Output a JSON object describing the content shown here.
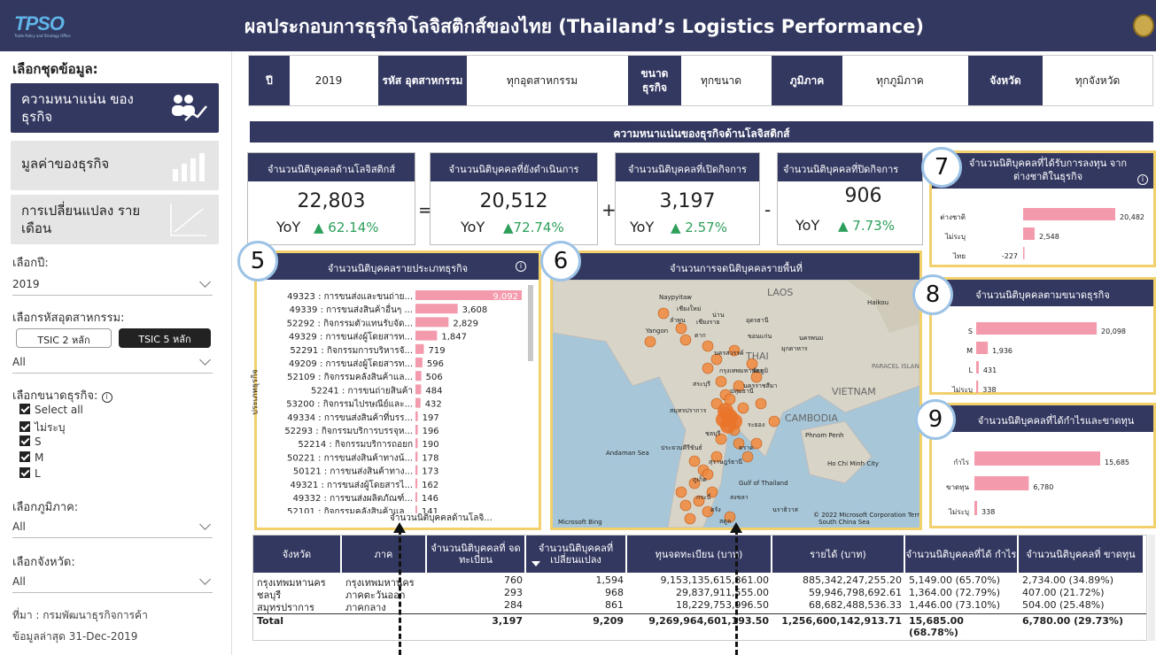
{
  "header": {
    "logo": "TPSO",
    "logo_sub": "Trade Policy and Strategy Office",
    "title": "ผลประกอบการธุรกิจโลจิสติกส์ของไทย (Thailand’s Logistics Performance)"
  },
  "sidebar": {
    "heading": "เลือกชุดข้อมูล:",
    "nav": [
      {
        "label": "ความหนาแน่น ของธุรกิจ"
      },
      {
        "label": "มูลค่าของธุรกิจ"
      },
      {
        "label": "การเปลี่ยนแปลง รายเดือน"
      }
    ],
    "year_label": "เลือกปี:",
    "year_value": "2019",
    "tsic_label": "เลือกรหัสอุตสาหกรรม:",
    "tsic2": "TSIC 2 หลัก",
    "tsic5": "TSIC 5 หลัก",
    "tsic_value": "All",
    "size_label": "เลือกขนาดธุรกิจ:",
    "size_options": [
      "Select all",
      "ไม่ระบุ",
      "S",
      "M",
      "L"
    ],
    "region_label": "เลือกภูมิภาค:",
    "region_value": "All",
    "province_label": "เลือกจังหวัด:",
    "province_value": "All",
    "source": "ที่มา : กรมพัฒนาธุรกิจการค้า",
    "updated": "ข้อมูลล่าสุด 31-Dec-2019"
  },
  "filters": [
    {
      "key": "ปี",
      "value": "2019"
    },
    {
      "key": "รหัส อุตสาหกรรม",
      "value": "ทุกอุตสาหกรรม"
    },
    {
      "key": "ขนาด ธุรกิจ",
      "value": "ทุกขนาด"
    },
    {
      "key": "ภูมิภาค",
      "value": "ทุกภูมิภาค"
    },
    {
      "key": "จังหวัด",
      "value": "ทุกจังหวัด"
    }
  ],
  "section_title": "ความหนาแน่นของธุรกิจด้านโลจิสติกส์",
  "kpis": [
    {
      "title": "จำนวนนิติบุคคลด้านโลจิสติกส์",
      "value": "22,803",
      "yoy_label": "YoY",
      "yoy": "▲ 62.14%"
    },
    {
      "title": "จำนวนนิติบุคคลที่ยังดำเนินการ",
      "value": "20,512",
      "yoy_label": "YoY",
      "yoy": "▲72.74%"
    },
    {
      "title": "จำนวนนิติบุคคลที่เปิดกิจการ",
      "value": "3,197",
      "yoy_label": "YoY",
      "yoy": "▲ 2.57%"
    },
    {
      "title": "จำนวนนิติบุคคลที่ปิดกิจการ",
      "value": "906",
      "yoy_label": "YoY",
      "yoy": "▲ 7.73%"
    }
  ],
  "operators": [
    "=",
    "+",
    "-"
  ],
  "callouts": [
    "5",
    "6",
    "7",
    "8",
    "9"
  ],
  "info_glyph": "i",
  "panel5": {
    "title": "จำนวนนิติบุคคลรายประเภทธุรกิจ",
    "axis_y": "ประเภทธุรกิจ",
    "axis_x": "จำนวนนิติบุคคลด้านโลจิ..."
  },
  "panel6": {
    "title": "จำนวนการจดนิติบุคคลรายพื้นที่",
    "labels": [
      "Naypyitaw",
      "เชียงใหม่",
      "น่าน",
      "LAOS",
      "ลำพูน",
      "เชียงราย",
      "อุดรธานี",
      "Yangon",
      "ตาก",
      "ขอนแก่น",
      "นครพนม",
      "นครสวรรค์",
      "มุกดาหาร",
      "THAI",
      "ชัยภูมิ",
      "กรุงเทพมหานคร",
      "สระบุรี",
      "นครราชสีมา",
      "VIETNAM",
      "ปทุมธานี",
      "CAMBODIA",
      "สมุทรปราการ",
      "ระยอง",
      "ชลบุรี",
      "ประจวบคีรีขันธ์",
      "ตราด",
      "Phnom Penh",
      "Ho Chi Minh City",
      "สุราษฎร์ธานี",
      "ภูเก็ต",
      "Gulf of Thailand",
      "กระบี่",
      "สงขลา",
      "ตรัง",
      "นราธิวาส",
      "สตูล",
      "Andaman Sea",
      "South China Sea",
      "Microsoft Bing",
      "© 2022 Microsoft Corporation Terms",
      "Haikou",
      "PARACEL ISLANDS"
    ]
  },
  "panel7": {
    "title": "จำนวนนิติบุคคลที่ได้รับการลงทุน จากต่างชาติในธุรกิจ"
  },
  "panel8": {
    "title": "จำนวนนิติบุคคลตามขนาดธุรกิจ"
  },
  "panel9": {
    "title": "จำนวนนิติบุคคลที่ได้กำไรและขาดทุน"
  },
  "chart_data": [
    {
      "type": "bar",
      "id": "business-type",
      "categories": [
        "49323 : การขนส่งและขนถ่าย...",
        "49339 : การขนส่งสินค้าอื่นๆ ...",
        "52292 : กิจกรรมตัวแทนรับจัด...",
        "49329 : การขนส่งผู้โดยสารท...",
        "52291 : กิจกรรมการบริหารจั...",
        "49209 : การขนส่งผู้โดยสารท...",
        "52109 : กิจกรรมคลังสินค้าแล...",
        "52241 : การขนถ่ายสินค้า",
        "53200 : กิจกรรมไปรษณีย์และ...",
        "49334 : การขนส่งสินค้าที่บรร...",
        "52293 : กิจกรรมบริการบรรจุห...",
        "52214 : กิจกรรมบริการถอยก",
        "50221 : การขนส่งสินค้าทางน้...",
        "50121 : การขนส่งสินค้าทาง...",
        "49321 : การขนส่งผู้โดยสารไ...",
        "49332 : การขนส่งผลิตภัณฑ์...",
        "52101 : กิจกรรมคลังสินค้าแล..."
      ],
      "values": [
        9092,
        3608,
        2829,
        1847,
        719,
        596,
        506,
        484,
        432,
        197,
        196,
        190,
        178,
        173,
        162,
        146,
        141
      ],
      "labels": [
        "9,092",
        "3,608",
        "2,829",
        "1,847",
        "719",
        "596",
        "506",
        "484",
        "432",
        "197",
        "196",
        "190",
        "178",
        "173",
        "162",
        "146",
        "141"
      ],
      "xmax": 9092
    },
    {
      "type": "bar",
      "id": "foreign-investment",
      "categories": [
        "ต่างชาติ",
        "ไม่ระบุ",
        "ไทย"
      ],
      "values": [
        20482,
        2548,
        -227
      ],
      "labels": [
        "20,482",
        "2,548",
        "-227"
      ],
      "xmax": 20482
    },
    {
      "type": "bar",
      "id": "business-size",
      "categories": [
        "S",
        "M",
        "L",
        "ไม่ระบุ"
      ],
      "values": [
        20098,
        1936,
        431,
        338
      ],
      "labels": [
        "20,098",
        "1,936",
        "431",
        "338"
      ],
      "xmax": 20098
    },
    {
      "type": "bar",
      "id": "profit-loss",
      "categories": [
        "กำไร",
        "ขาดทุน",
        "ไม่ระบุ"
      ],
      "values": [
        15685,
        6780,
        338
      ],
      "labels": [
        "15,685",
        "6,780",
        "338"
      ],
      "xmax": 15685
    }
  ],
  "table": {
    "headers": [
      "จังหวัด",
      "ภาค",
      "จำนวนนิติบุคคลที่ จดทะเบียน",
      "จำนวนนิติบุคคลที่ เปลี่ยนแปลง",
      "ทุนจดทะเบียน (บาท)",
      "รายได้ (บาท)",
      "จำนวนนิติบุคคลที่ได้ กำไร",
      "จำนวนนิติบุคคลที่ ขาดทุน"
    ],
    "rows": [
      [
        "กรุงเทพมหานคร",
        "กรุงเทพมหานคร",
        "760",
        "1,594",
        "9,153,135,615,861.00",
        "885,342,247,255.20",
        "5,149.00 (65.70%)",
        "2,734.00 (34.89%)"
      ],
      [
        "ชลบุรี",
        "ภาคตะวันออก",
        "293",
        "968",
        "29,837,911,555.00",
        "59,946,798,692.61",
        "1,364.00 (72.79%)",
        "407.00 (21.72%)"
      ],
      [
        "สมุทรปราการ",
        "ภาคกลาง",
        "284",
        "861",
        "18,229,753,996.50",
        "68,682,488,536.33",
        "1,446.00 (73.10%)",
        "504.00 (25.48%)"
      ],
      [
        "Total",
        "",
        "3,197",
        "9,209",
        "9,269,964,601,193.50",
        "1,256,600,142,913.71",
        "15,685.00 (68.78%)",
        "6,780.00 (29.73%)"
      ]
    ]
  }
}
